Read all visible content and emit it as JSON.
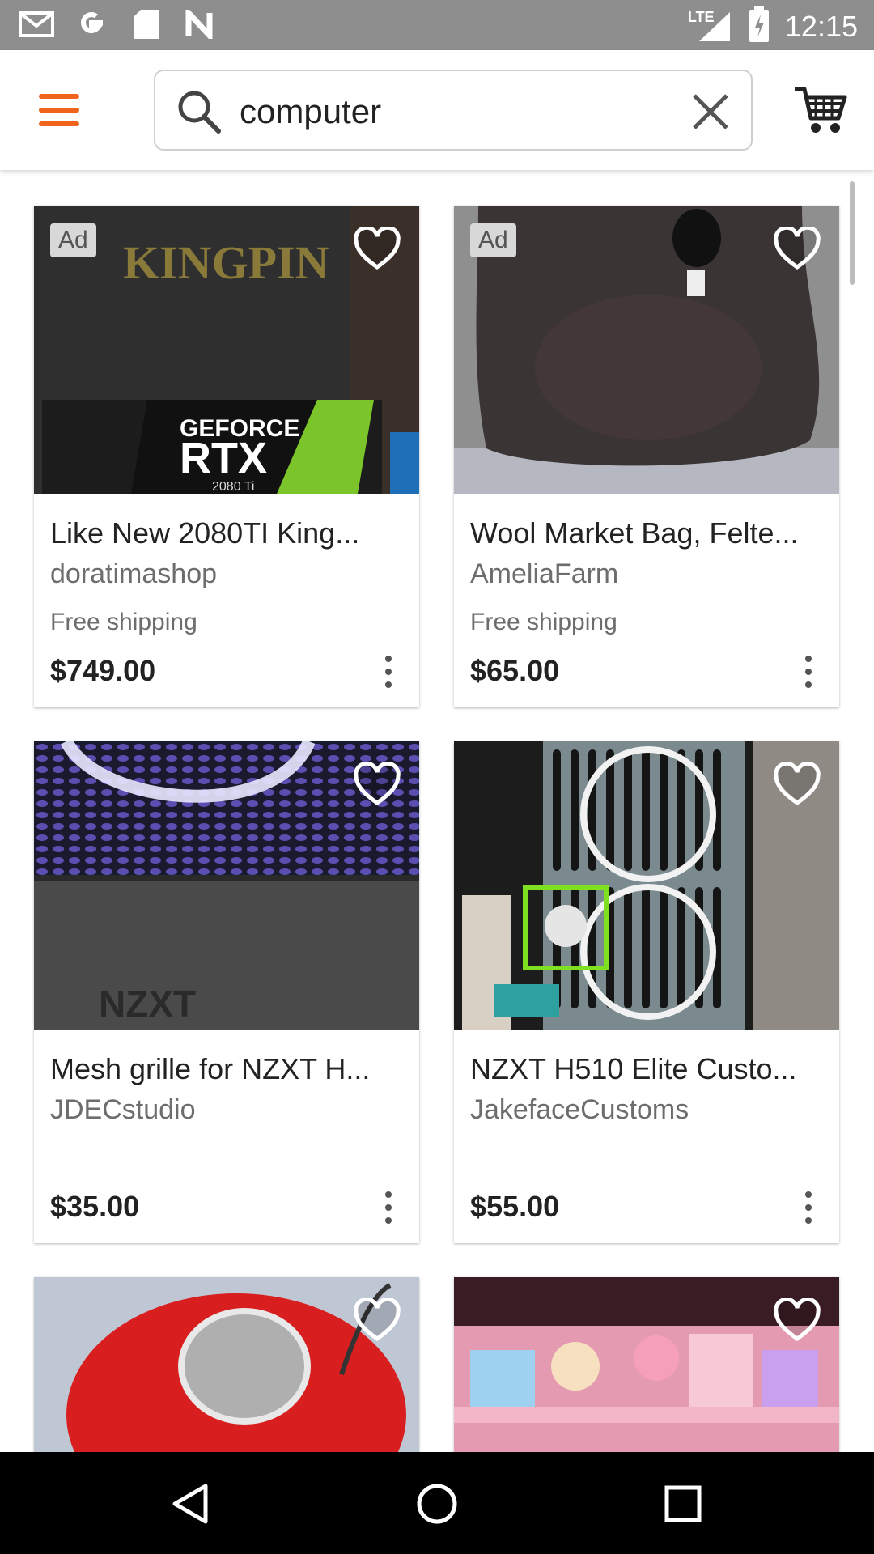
{
  "status_bar": {
    "time": "12:15",
    "network": "LTE",
    "icons": [
      "gmail-icon",
      "google-icon",
      "sd-card-icon",
      "n-icon",
      "signal-icon",
      "battery-icon"
    ]
  },
  "search": {
    "value": "computer"
  },
  "products": [
    {
      "badge": "Ad",
      "title": "Like New 2080TI King...",
      "shop": "doratimashop",
      "shipping": "Free shipping",
      "price": "$749.00"
    },
    {
      "badge": "Ad",
      "title": "Wool Market Bag, Felte...",
      "shop": "AmeliaFarm",
      "shipping": "Free shipping",
      "price": "$65.00"
    },
    {
      "title": "Mesh grille for NZXT H...",
      "shop": "JDECstudio",
      "price": "$35.00"
    },
    {
      "title": "NZXT H510 Elite Custo...",
      "shop": "JakefaceCustoms",
      "price": "$55.00"
    }
  ],
  "image_text": {
    "gpu_top": "KINGPIN",
    "gpu_brand": "GEFORCE",
    "gpu_model": "RTX",
    "gpu_sub": "2080 Ti",
    "nzxt": "NZXT"
  },
  "colors": {
    "accent": "#f1641e",
    "statusbar": "#8e8e8e",
    "navbar": "#000000"
  }
}
